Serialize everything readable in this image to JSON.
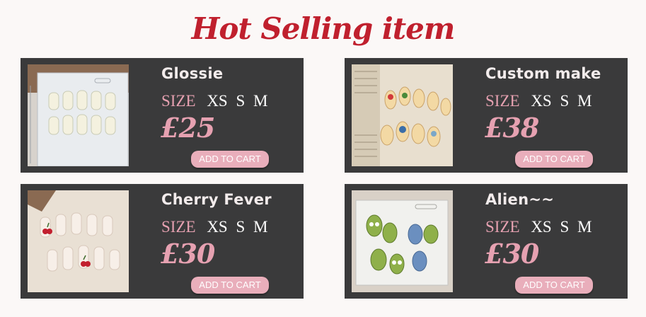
{
  "page": {
    "title": "Hot Selling item"
  },
  "products": [
    {
      "name": "Glossie",
      "size_label": "SIZE",
      "sizes": [
        "XS",
        "S",
        "M"
      ],
      "price": "£25",
      "cart_label": "ADD TO CART",
      "image_icon": "glossie-nails-image"
    },
    {
      "name": "Custom make",
      "size_label": "SIZE",
      "sizes": [
        "XS",
        "S",
        "M"
      ],
      "price": "£38",
      "cart_label": "ADD TO CART",
      "image_icon": "custom-make-nails-image"
    },
    {
      "name": "Cherry Fever",
      "size_label": "SIZE",
      "sizes": [
        "XS",
        "S",
        "M"
      ],
      "price": "£30",
      "cart_label": "ADD TO CART",
      "image_icon": "cherry-fever-nails-image"
    },
    {
      "name": "Alien~~",
      "size_label": "SIZE",
      "sizes": [
        "XS",
        "S",
        "M"
      ],
      "price": "£30",
      "cart_label": "ADD TO CART",
      "image_icon": "alien-nails-image"
    }
  ],
  "colors": {
    "title": "#c0202e",
    "card_background": "#3a3a3b",
    "accent_pink": "#e6a1b1",
    "button_pink": "#e9aebb"
  }
}
